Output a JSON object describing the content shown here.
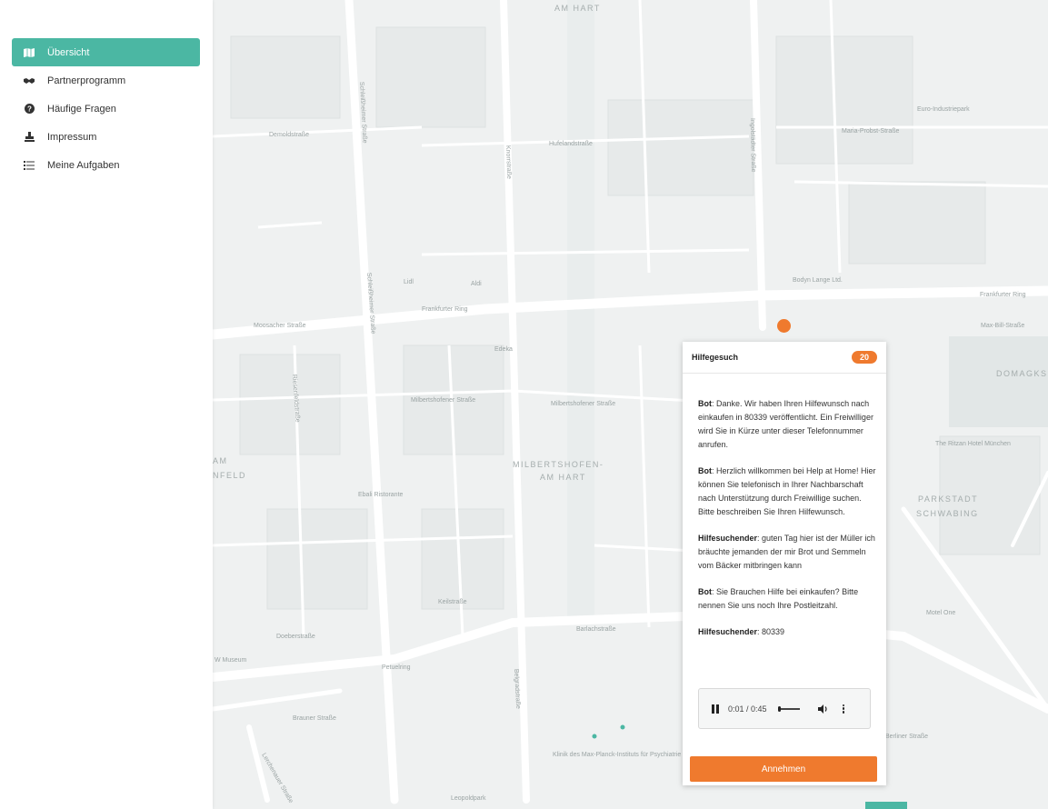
{
  "sidebar": {
    "items": [
      {
        "label": "Übersicht",
        "icon": "map-icon",
        "active": true
      },
      {
        "label": "Partnerprogramm",
        "icon": "handshake-icon",
        "active": false
      },
      {
        "label": "Häufige Fragen",
        "icon": "question-circle-icon",
        "active": false
      },
      {
        "label": "Impressum",
        "icon": "stamp-icon",
        "active": false
      },
      {
        "label": "Meine Aufgaben",
        "icon": "task-list-icon",
        "active": false
      }
    ]
  },
  "map": {
    "areas": [
      "AM HART",
      "MILBERTSHOFEN-",
      "AM HART",
      "PARKSTADT",
      "SCHWABING",
      "DOMAGKS",
      "AM",
      "NFELD"
    ],
    "roads": [
      "Demoldstraße",
      "Schleißheimer Straße",
      "Knorrstraße",
      "Hufelandstraße",
      "Ingolstädter Straße",
      "Euro-Industriepark",
      "Maria-Probst-Straße",
      "Lidl",
      "Aldi",
      "Frankfurter Ring",
      "Moosacher Straße",
      "Frankfurter Ring",
      "Max-Bill-Straße",
      "Bodyn Lange Ltd.",
      "Edeka",
      "Milbertshofener Straße",
      "Milbertshofener Straße",
      "Schleißheimer Straße",
      "Riesenfeldstraße",
      "Ebali Ristorante",
      "Keilstraße",
      "Doeberstraße",
      "Petuelring",
      "Barlachstraße",
      "Belgradstraße",
      "Brauner Straße",
      "W Museum",
      "Leopoldpark",
      "Klinik des Max-Planck-Instituts für Psychiatrie",
      "The Ritzan Hotel München",
      "Motel One",
      "Berliner Straße",
      "Lerchenauer Straße"
    ]
  },
  "popup": {
    "title": "Hilfegesuch",
    "badge": "20",
    "messages": [
      {
        "speaker": "Bot",
        "text": ": Danke. Wir haben Ihren Hilfewunsch nach einkaufen in 80339 veröffentlicht. Ein Freiwilliger wird Sie in Kürze unter dieser Telefonnummer anrufen."
      },
      {
        "speaker": "Bot",
        "text": ": Herzlich willkommen bei Help at Home! Hier können Sie telefonisch in Ihrer Nachbarschaft nach Unterstützung durch Freiwillige suchen. Bitte beschreiben Sie Ihren Hilfewunsch."
      },
      {
        "speaker": "Hilfesuchender",
        "text": ": guten Tag hier ist der Müller ich bräuchte jemanden der mir Brot und Semmeln vom Bäcker mitbringen kann"
      },
      {
        "speaker": "Bot",
        "text": ": Sie Brauchen Hilfe bei einkaufen? Bitte nennen Sie uns noch Ihre Postleitzahl."
      },
      {
        "speaker": "Hilfesuchender",
        "text": ": 80339"
      }
    ],
    "audio": {
      "time": "0:01 / 0:45",
      "progress": 0.02
    },
    "accept_label": "Annehmen"
  },
  "colors": {
    "accent": "#4bb7a3",
    "orange": "#ef7a2e"
  }
}
